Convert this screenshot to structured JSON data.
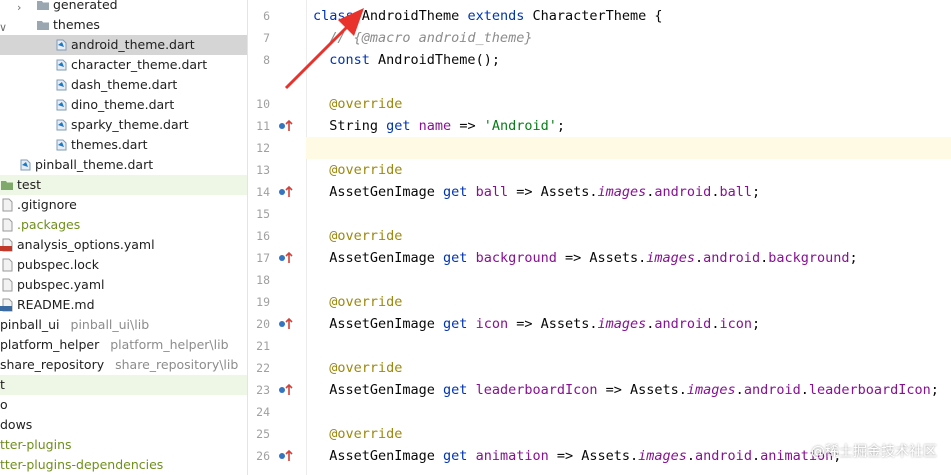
{
  "tree": {
    "items": [
      {
        "label": "generated",
        "hint": "",
        "kind": "folder",
        "chev": "›"
      },
      {
        "label": "themes",
        "hint": "",
        "kind": "folder",
        "chev": "⌄"
      },
      {
        "label": "android_theme.dart",
        "hint": "",
        "kind": "dart"
      },
      {
        "label": "character_theme.dart",
        "hint": "",
        "kind": "dart"
      },
      {
        "label": "dash_theme.dart",
        "hint": "",
        "kind": "dart"
      },
      {
        "label": "dino_theme.dart",
        "hint": "",
        "kind": "dart"
      },
      {
        "label": "sparky_theme.dart",
        "hint": "",
        "kind": "dart"
      },
      {
        "label": "themes.dart",
        "hint": "",
        "kind": "dart"
      },
      {
        "label": "pinball_theme.dart",
        "hint": "",
        "kind": "dart"
      },
      {
        "label": "test",
        "hint": "",
        "kind": "testfolder"
      },
      {
        "label": ".gitignore",
        "hint": "",
        "kind": "file"
      },
      {
        "label": ".packages",
        "hint": "",
        "kind": "file"
      },
      {
        "label": "analysis_options.yaml",
        "hint": "",
        "kind": "yaml"
      },
      {
        "label": "pubspec.lock",
        "hint": "",
        "kind": "file"
      },
      {
        "label": "pubspec.yaml",
        "hint": "",
        "kind": "file"
      },
      {
        "label": "README.md",
        "hint": "",
        "kind": "md"
      },
      {
        "label": "pinball_ui",
        "hint": "pinball_ui\\lib",
        "kind": "module"
      },
      {
        "label": "platform_helper",
        "hint": "platform_helper\\lib",
        "kind": "module"
      },
      {
        "label": "share_repository",
        "hint": "share_repository\\lib",
        "kind": "module"
      },
      {
        "label": "t",
        "hint": "",
        "kind": "module"
      },
      {
        "label": "o",
        "hint": "",
        "kind": "module"
      },
      {
        "label": "dows",
        "hint": "",
        "kind": "module"
      },
      {
        "label": "tter-plugins",
        "hint": "",
        "kind": "lib"
      },
      {
        "label": "tter-plugins-dependencies",
        "hint": "",
        "kind": "lib"
      }
    ]
  },
  "editor": {
    "line_numbers": [
      "6",
      "7",
      "8",
      "",
      "10",
      "11",
      "12",
      "13",
      "14",
      "15",
      "16",
      "17",
      "18",
      "19",
      "20",
      "21",
      "22",
      "23",
      "24",
      "25",
      "26"
    ],
    "lines": [
      [
        {
          "t": "class ",
          "c": "kw"
        },
        {
          "t": "AndroidTheme ",
          "c": "plain"
        },
        {
          "t": "extends ",
          "c": "kw"
        },
        {
          "t": "CharacterTheme {",
          "c": "plain"
        }
      ],
      [
        {
          "t": "  // {@macro android_theme}",
          "c": "cmt"
        }
      ],
      [
        {
          "t": "  const ",
          "c": "kw"
        },
        {
          "t": "AndroidTheme();",
          "c": "plain"
        }
      ],
      [],
      [
        {
          "t": "  @override",
          "c": "ann"
        }
      ],
      [
        {
          "t": "  String ",
          "c": "plain"
        },
        {
          "t": "get ",
          "c": "kw"
        },
        {
          "t": "name ",
          "c": "fld"
        },
        {
          "t": "=> ",
          "c": "plain"
        },
        {
          "t": "'Android'",
          "c": "str"
        },
        {
          "t": ";",
          "c": "plain"
        }
      ],
      [],
      [
        {
          "t": "  @override",
          "c": "ann"
        }
      ],
      [
        {
          "t": "  AssetGenImage ",
          "c": "plain"
        },
        {
          "t": "get ",
          "c": "kw"
        },
        {
          "t": "ball ",
          "c": "fld"
        },
        {
          "t": "=> Assets.",
          "c": "plain"
        },
        {
          "t": "images",
          "c": "ital"
        },
        {
          "t": ".",
          "c": "plain"
        },
        {
          "t": "android",
          "c": "fld"
        },
        {
          "t": ".",
          "c": "plain"
        },
        {
          "t": "ball",
          "c": "fld"
        },
        {
          "t": ";",
          "c": "plain"
        }
      ],
      [],
      [
        {
          "t": "  @override",
          "c": "ann"
        }
      ],
      [
        {
          "t": "  AssetGenImage ",
          "c": "plain"
        },
        {
          "t": "get ",
          "c": "kw"
        },
        {
          "t": "background ",
          "c": "fld"
        },
        {
          "t": "=> Assets.",
          "c": "plain"
        },
        {
          "t": "images",
          "c": "ital"
        },
        {
          "t": ".",
          "c": "plain"
        },
        {
          "t": "android",
          "c": "fld"
        },
        {
          "t": ".",
          "c": "plain"
        },
        {
          "t": "background",
          "c": "fld"
        },
        {
          "t": ";",
          "c": "plain"
        }
      ],
      [],
      [
        {
          "t": "  @override",
          "c": "ann"
        }
      ],
      [
        {
          "t": "  AssetGenImage ",
          "c": "plain"
        },
        {
          "t": "get ",
          "c": "kw"
        },
        {
          "t": "icon ",
          "c": "fld"
        },
        {
          "t": "=> Assets.",
          "c": "plain"
        },
        {
          "t": "images",
          "c": "ital"
        },
        {
          "t": ".",
          "c": "plain"
        },
        {
          "t": "android",
          "c": "fld"
        },
        {
          "t": ".",
          "c": "plain"
        },
        {
          "t": "icon",
          "c": "fld"
        },
        {
          "t": ";",
          "c": "plain"
        }
      ],
      [],
      [
        {
          "t": "  @override",
          "c": "ann"
        }
      ],
      [
        {
          "t": "  AssetGenImage ",
          "c": "plain"
        },
        {
          "t": "get ",
          "c": "kw"
        },
        {
          "t": "leaderboardIcon ",
          "c": "fld"
        },
        {
          "t": "=> Assets.",
          "c": "plain"
        },
        {
          "t": "images",
          "c": "ital"
        },
        {
          "t": ".",
          "c": "plain"
        },
        {
          "t": "android",
          "c": "fld"
        },
        {
          "t": ".",
          "c": "plain"
        },
        {
          "t": "leaderboardIcon",
          "c": "fld"
        },
        {
          "t": ";",
          "c": "plain"
        }
      ],
      [],
      [
        {
          "t": "  @override",
          "c": "ann"
        }
      ],
      [
        {
          "t": "  AssetGenImage ",
          "c": "plain"
        },
        {
          "t": "get ",
          "c": "kw"
        },
        {
          "t": "animation ",
          "c": "fld"
        },
        {
          "t": "=> Assets.",
          "c": "plain"
        },
        {
          "t": "images",
          "c": "ital"
        },
        {
          "t": ".",
          "c": "plain"
        },
        {
          "t": "android",
          "c": "fld"
        },
        {
          "t": ".",
          "c": "plain"
        },
        {
          "t": "animation",
          "c": "fld"
        },
        {
          "t": ";",
          "c": "plain"
        }
      ]
    ],
    "current_line_index": 6
  },
  "watermark": "@稀土掘金技术社区",
  "colors": {
    "accent_arrow": "#e8322b",
    "selection": "#d5d5d5",
    "current_line": "#fffae3",
    "test_row": "#eef6e6"
  }
}
